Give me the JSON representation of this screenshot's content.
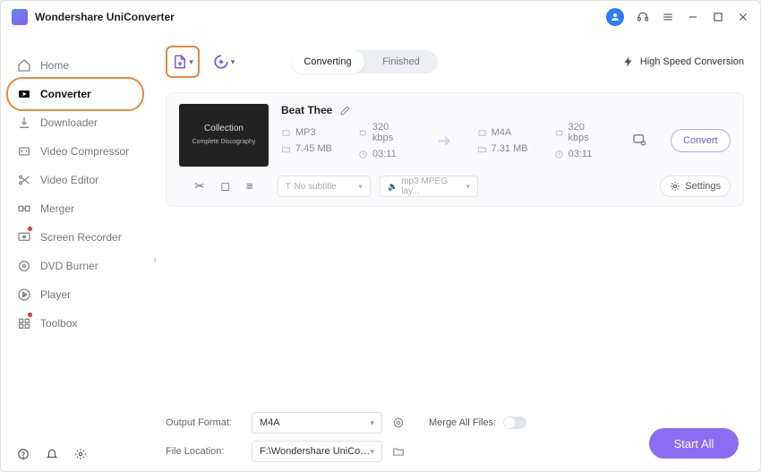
{
  "app": {
    "title": "Wondershare UniConverter"
  },
  "sidebar": {
    "items": [
      {
        "label": "Home"
      },
      {
        "label": "Converter"
      },
      {
        "label": "Downloader"
      },
      {
        "label": "Video Compressor"
      },
      {
        "label": "Video Editor"
      },
      {
        "label": "Merger"
      },
      {
        "label": "Screen Recorder"
      },
      {
        "label": "DVD Burner"
      },
      {
        "label": "Player"
      },
      {
        "label": "Toolbox"
      }
    ]
  },
  "toolbar": {
    "tabs": {
      "converting": "Converting",
      "finished": "Finished"
    },
    "hsc": "High Speed Conversion"
  },
  "file": {
    "title": "Beat Thee",
    "src": {
      "format": "MP3",
      "bitrate": "320 kbps",
      "size": "7.45 MB",
      "duration": "03:11"
    },
    "dst": {
      "format": "M4A",
      "bitrate": "320 kbps",
      "size": "7.31 MB",
      "duration": "03:11"
    },
    "subtitle_sel": "No subtitle",
    "audio_sel": "mp3 MPEG lay...",
    "settings": "Settings",
    "convert": "Convert"
  },
  "footer": {
    "output_label": "Output Format:",
    "output_value": "M4A",
    "location_label": "File Location:",
    "location_value": "F:\\Wondershare UniConverter",
    "merge_label": "Merge All Files:",
    "start_all": "Start All"
  }
}
